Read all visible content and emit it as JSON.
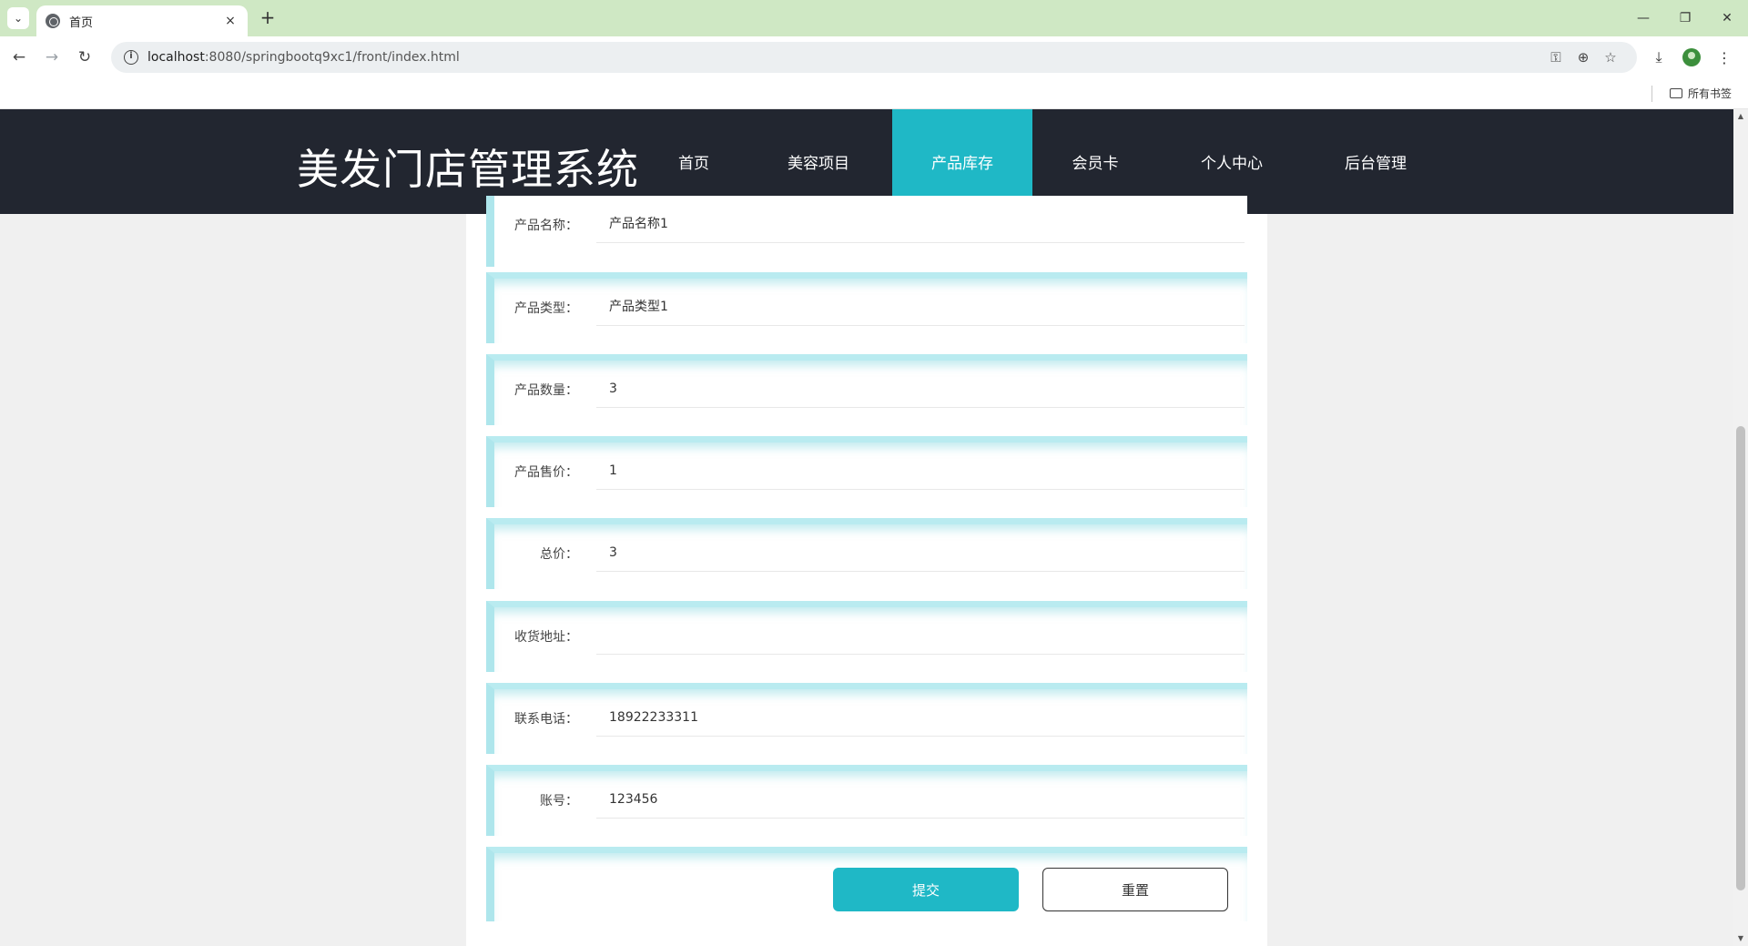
{
  "browser": {
    "tab_title": "首页",
    "tab_close": "×",
    "new_tab": "+",
    "url_host": "localhost",
    "url_rest": ":8080/springbootq9xc1/front/index.html",
    "bookmarks_all": "所有书签",
    "menu_glyph": "⌄",
    "back": "←",
    "forward": "→",
    "reload": "↻",
    "minimize": "—",
    "restore": "❐",
    "close": "✕",
    "key_glyph": "⚿",
    "zoom_glyph": "⊕",
    "star_glyph": "☆",
    "download_glyph": "⤓",
    "more_glyph": "⋮",
    "info_glyph": "i"
  },
  "site": {
    "title": "美发门店管理系统",
    "menu": [
      {
        "label": "首页"
      },
      {
        "label": "美容项目"
      },
      {
        "label": "产品库存"
      },
      {
        "label": "会员卡"
      },
      {
        "label": "个人中心"
      },
      {
        "label": "后台管理"
      }
    ],
    "active_menu": "产品库存"
  },
  "form": {
    "fields": [
      {
        "label": "产品名称：",
        "value": "产品名称1"
      },
      {
        "label": "产品类型：",
        "value": "产品类型1"
      },
      {
        "label": "产品数量：",
        "value": "3"
      },
      {
        "label": "产品售价：",
        "value": "1"
      },
      {
        "label": "总价：",
        "value": "3"
      },
      {
        "label": "收货地址：",
        "value": ""
      },
      {
        "label": "联系电话：",
        "value": "18922233311"
      },
      {
        "label": "账号：",
        "value": "123456"
      }
    ],
    "submit_label": "提交",
    "reset_label": "重置"
  },
  "colors": {
    "accent": "#1fb8c6",
    "header_bg": "#222630",
    "chrome_green": "#cfe8c4"
  }
}
